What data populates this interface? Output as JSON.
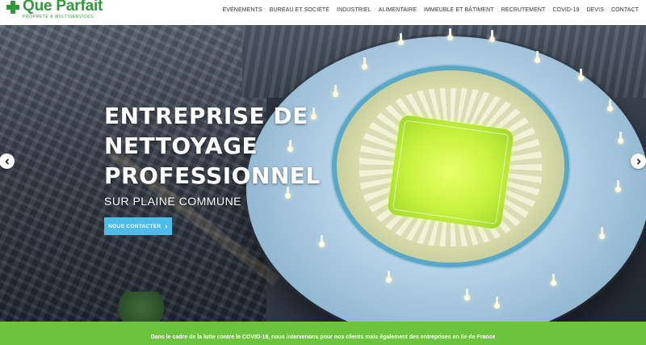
{
  "logo": {
    "name": "Que Parfait",
    "tagline": "PROPRETÉ & MULTISERVICES",
    "icon": "plus-icon",
    "color": "#2e9a3a"
  },
  "nav": {
    "items": [
      {
        "label": "ÉVÉNEMENTS"
      },
      {
        "label": "BUREAU ET SOCIÉTÉ"
      },
      {
        "label": "INDUSTRIEL"
      },
      {
        "label": "ALIMENTAIRE"
      },
      {
        "label": "IMMEUBLE ET BÂTIMENT"
      },
      {
        "label": "RECRUTEMENT"
      },
      {
        "label": "COVID-19"
      },
      {
        "label": "DEVIS"
      },
      {
        "label": "CONTACT"
      }
    ]
  },
  "hero": {
    "title_lines": [
      "ENTREPRISE DE",
      "NETTOYAGE",
      "PROFESSIONNEL"
    ],
    "subtitle": "SUR PLAINE COMMUNE",
    "button_label": "NOUS CONTACTER",
    "button_icon": "chevron-right-icon",
    "button_color": "#4fbbe8",
    "prev_icon": "chevron-left-icon",
    "next_icon": "chevron-right-icon",
    "image_subject": "stadium aerial view"
  },
  "banner": {
    "text": "Dans le cadre de la lutte contre le COVID-19, nous intervenons pour nos clients mais également des entreprises en Ile de France",
    "color": "#6cc43e"
  }
}
